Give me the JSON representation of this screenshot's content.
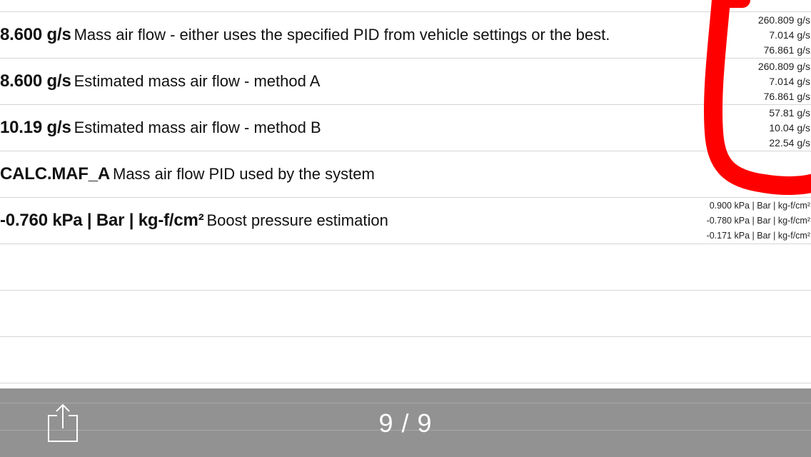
{
  "rows": [
    {
      "value": "",
      "description": "",
      "stats": [
        "",
        "",
        ""
      ]
    },
    {
      "value": "8.600 g/s",
      "description": "Mass air flow - either uses the specified PID from vehicle settings or the best.",
      "stats": [
        "260.809 g/s",
        "7.014 g/s",
        "76.861 g/s"
      ]
    },
    {
      "value": "8.600 g/s",
      "description": "Estimated mass air flow - method A",
      "stats": [
        "260.809 g/s",
        "7.014 g/s",
        "76.861 g/s"
      ]
    },
    {
      "value": "10.19 g/s",
      "description": "Estimated mass air flow - method B",
      "stats": [
        "57.81 g/s",
        "10.04 g/s",
        "22.54 g/s"
      ]
    },
    {
      "value": "CALC.MAF_A",
      "description": "Mass air flow PID used by the system",
      "stats": []
    },
    {
      "value": "-0.760 kPa | Bar | kg-f/cm²",
      "description": "Boost pressure estimation",
      "stats": [
        "0.900 kPa | Bar | kg-f/cm²",
        "-0.780 kPa | Bar | kg-f/cm²",
        "-0.171 kPa | Bar | kg-f/cm²"
      ]
    }
  ],
  "toolbar": {
    "share_icon": "share-icon",
    "page_indicator": "9 / 9",
    "background_color": "#929292"
  },
  "annotation": {
    "color": "#ff0000",
    "shape": "hand-drawn circle around min/max/avg columns"
  }
}
